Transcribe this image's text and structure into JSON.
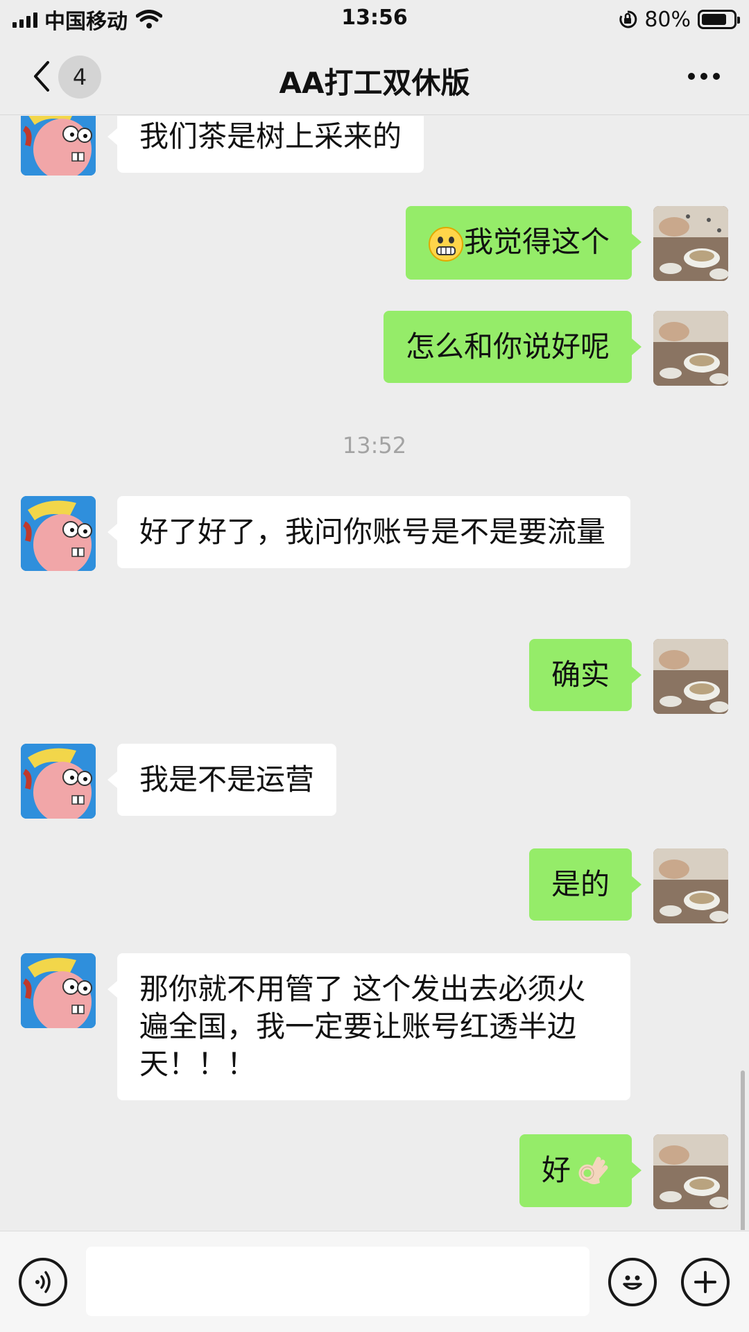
{
  "status_bar": {
    "carrier": "中国移动",
    "time": "13:56",
    "battery": "80%",
    "battery_level": 0.8
  },
  "nav": {
    "unread_count": "4",
    "title": "AA打工双休版"
  },
  "chat": {
    "messages": [
      {
        "side": "left",
        "text": "我们茶是树上采来的"
      },
      {
        "side": "right",
        "emoji": "grimacing-face",
        "text": "我觉得这个"
      },
      {
        "side": "right",
        "text": "怎么和你说好呢"
      },
      {
        "timestamp": "13:52"
      },
      {
        "side": "left",
        "text": "好了好了，我问你账号是不是要流量"
      },
      {
        "side": "right",
        "text": "确实"
      },
      {
        "side": "left",
        "text": "我是不是运营"
      },
      {
        "side": "right",
        "text": "是的"
      },
      {
        "side": "left",
        "text": "那你就不用管了 这个发出去必须火遍全国，我一定要让账号红透半边天！！！"
      },
      {
        "side": "right",
        "text": "好",
        "emoji": "ok-hand"
      }
    ]
  },
  "input_bar": {
    "text_value": ""
  },
  "colors": {
    "background": "#ededed",
    "sent_bubble": "#95ec69",
    "received_bubble": "#ffffff"
  }
}
